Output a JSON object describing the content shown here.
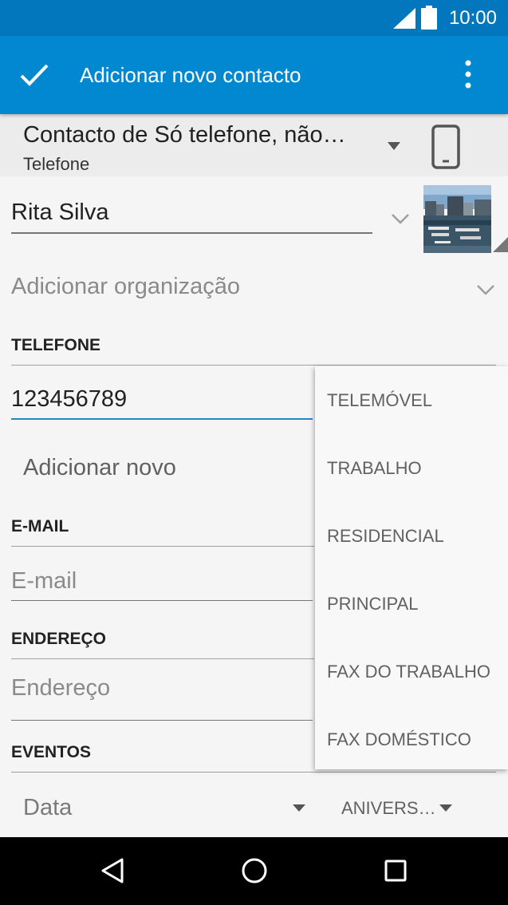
{
  "status_bar": {
    "time": "10:00",
    "icons": [
      "signal-icon",
      "battery-icon"
    ]
  },
  "app_bar": {
    "title": "Adicionar novo contacto",
    "icons": [
      "check-icon",
      "more-vert-icon"
    ]
  },
  "account": {
    "title": "Contacto de Só telefone, não…",
    "subtitle": "Telefone",
    "icon": "phone-icon"
  },
  "name": {
    "value": "Rita Silva"
  },
  "organization": {
    "label": "Adicionar organização"
  },
  "phone": {
    "section": "TELEFONE",
    "value": "123456789",
    "add_new": "Adicionar novo"
  },
  "email": {
    "section": "E-MAIL",
    "placeholder": "E-mail"
  },
  "address": {
    "section": "ENDEREÇO",
    "placeholder": "Endereço"
  },
  "events": {
    "section": "EVENTOS",
    "date_placeholder": "Data",
    "type_value": "ANIVERS…"
  },
  "phone_type_menu": {
    "items": [
      "TELEMÓVEL",
      "TRABALHO",
      "RESIDENCIAL",
      "PRINCIPAL",
      "FAX DO TRABALHO",
      "FAX DOMÉSTICO"
    ]
  },
  "colors": {
    "status_bar": "#0277bd",
    "app_bar": "#0288d1",
    "accent": "#1e88c7"
  },
  "nav_bar": {
    "icons": [
      "back-icon",
      "home-icon",
      "recents-icon"
    ]
  }
}
